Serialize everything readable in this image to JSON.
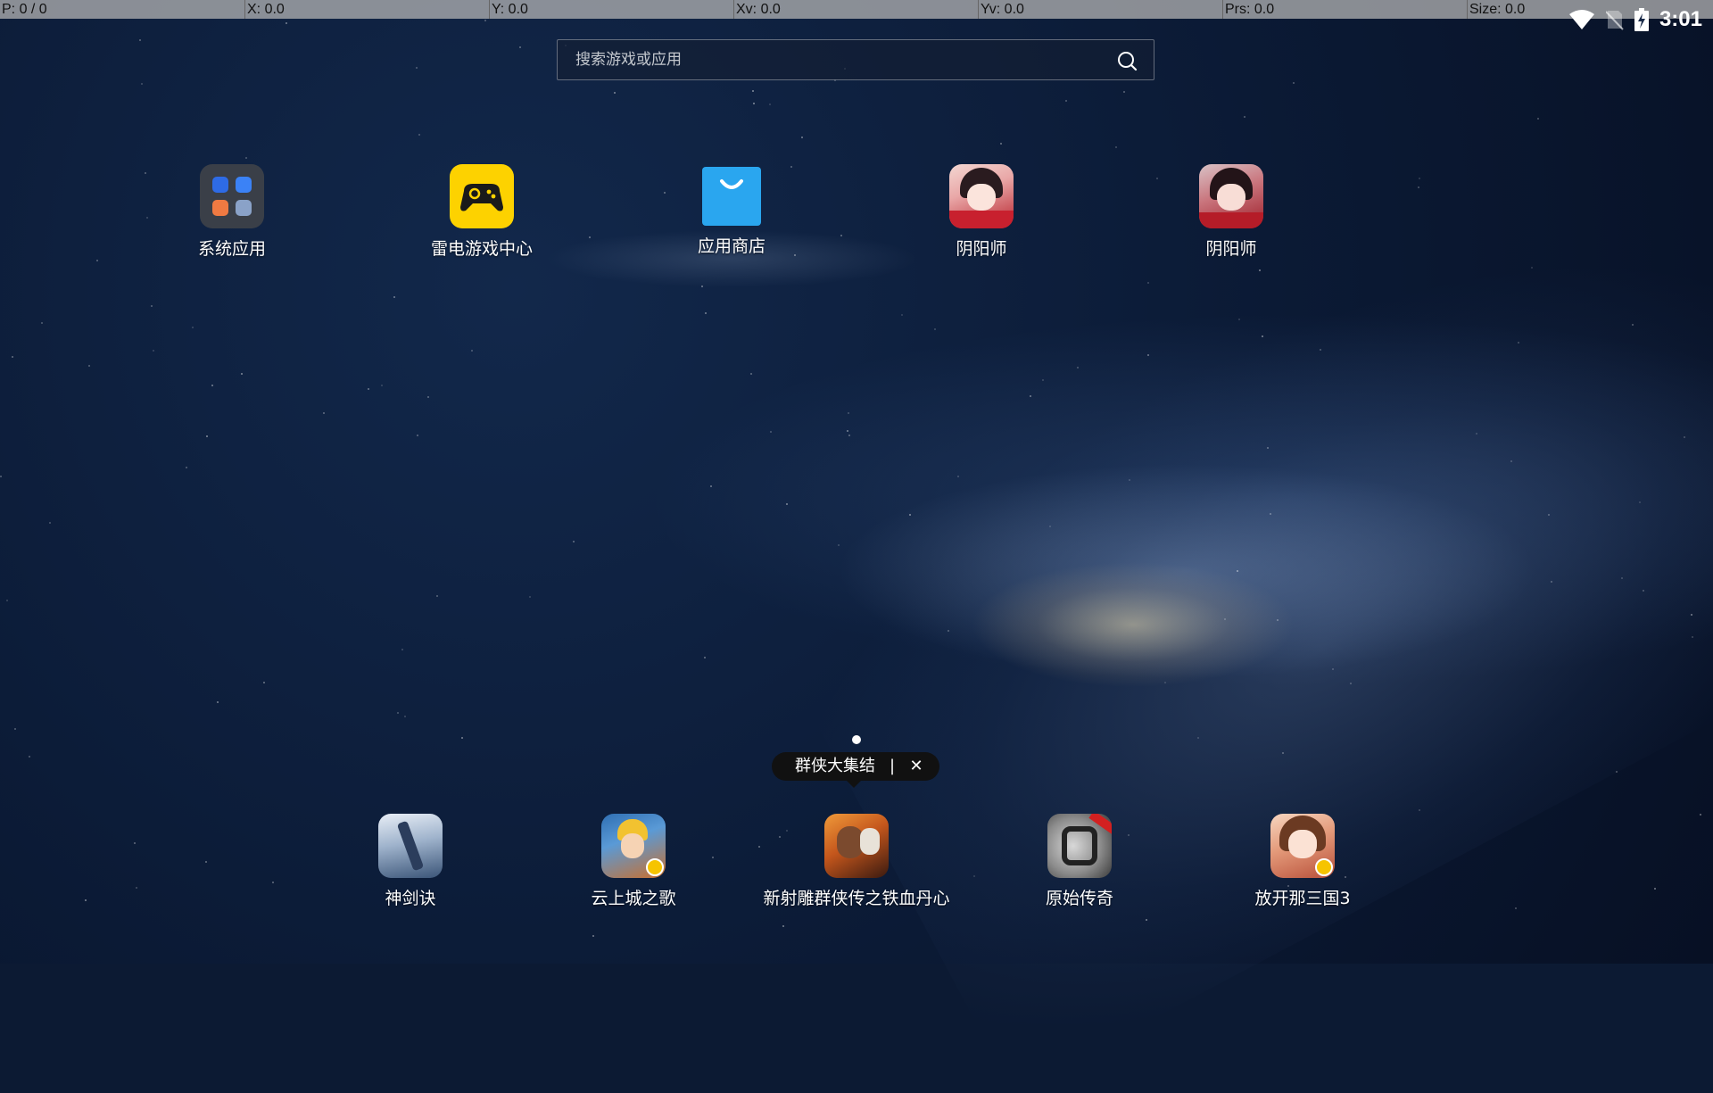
{
  "debug_bar": {
    "p": "P: 0 / 0",
    "x": "X: 0.0",
    "y": "Y: 0.0",
    "xv": "Xv: 0.0",
    "yv": "Yv: 0.0",
    "prs": "Prs: 0.0",
    "size": "Size: 0.0"
  },
  "status": {
    "time": "3:01",
    "icons": [
      "wifi-icon",
      "no-sim-icon",
      "battery-charging-icon"
    ]
  },
  "search": {
    "placeholder": "搜索游戏或应用",
    "icon": "search-icon"
  },
  "apps_top": [
    {
      "label": "系统应用",
      "icon": "system-apps-folder-icon"
    },
    {
      "label": "雷电游戏中心",
      "icon": "game-center-icon"
    },
    {
      "label": "应用商店",
      "icon": "app-store-icon"
    },
    {
      "label": "阴阳师",
      "icon": "onmyoji-icon"
    },
    {
      "label": "阴阳师",
      "icon": "onmyoji-icon"
    }
  ],
  "apps_bottom": [
    {
      "label": "神剑诀",
      "icon": "shenjianjue-icon"
    },
    {
      "label": "云上城之歌",
      "icon": "yunshangcheng-icon"
    },
    {
      "label": "新射雕群侠传之铁血丹心",
      "icon": "shediao-icon"
    },
    {
      "label": "原始传奇",
      "icon": "yuanshi-chuanqi-icon"
    },
    {
      "label": "放开那三国3",
      "icon": "fangkai-sanguo-icon"
    }
  ],
  "tooltip": {
    "text": "群侠大集结",
    "separator": "|",
    "close": "✕"
  },
  "colors": {
    "game_center_yellow": "#fdd200",
    "app_store_blue": "#2aa6ef"
  }
}
